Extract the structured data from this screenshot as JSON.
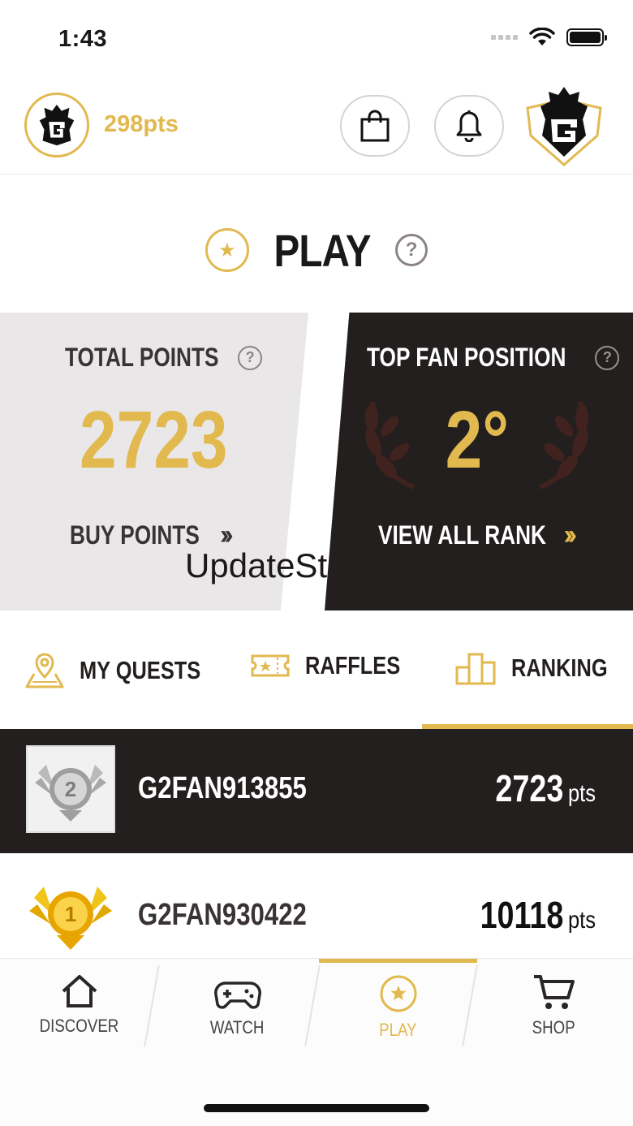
{
  "status_bar": {
    "time": "1:43"
  },
  "header": {
    "points": "298pts",
    "icons": [
      "g2-avatar-icon",
      "shopping-bag-icon",
      "bell-icon",
      "g2-team-logo"
    ]
  },
  "page": {
    "title": "PLAY"
  },
  "cards": {
    "total": {
      "label": "TOTAL POINTS",
      "value": "2723",
      "link": "BUY POINTS"
    },
    "rank": {
      "label": "TOP FAN POSITION",
      "value": "2°",
      "link": "VIEW ALL RANK"
    }
  },
  "overlay_text": "UpdateSt",
  "tabs": [
    {
      "label": "MY QUESTS",
      "icon": "map-pin-icon"
    },
    {
      "label": "RAFFLES",
      "icon": "ticket-icon"
    },
    {
      "label": "RANKING",
      "icon": "podium-icon",
      "active": true
    }
  ],
  "ranking": [
    {
      "rank": "2",
      "name": "G2FAN913855",
      "points": "2723",
      "unit": "pts",
      "is_me": true
    },
    {
      "rank": "1",
      "name": "G2FAN930422",
      "points": "10118",
      "unit": "pts",
      "is_me": false
    }
  ],
  "bottom_nav": [
    {
      "label": "DISCOVER",
      "icon": "home-icon"
    },
    {
      "label": "WATCH",
      "icon": "gamepad-icon"
    },
    {
      "label": "PLAY",
      "icon": "star-circle-icon",
      "active": true
    },
    {
      "label": "SHOP",
      "icon": "cart-icon"
    }
  ],
  "colors": {
    "accent": "#e2b94f",
    "dark": "#231f1e",
    "light_card": "#e9e7e7"
  }
}
